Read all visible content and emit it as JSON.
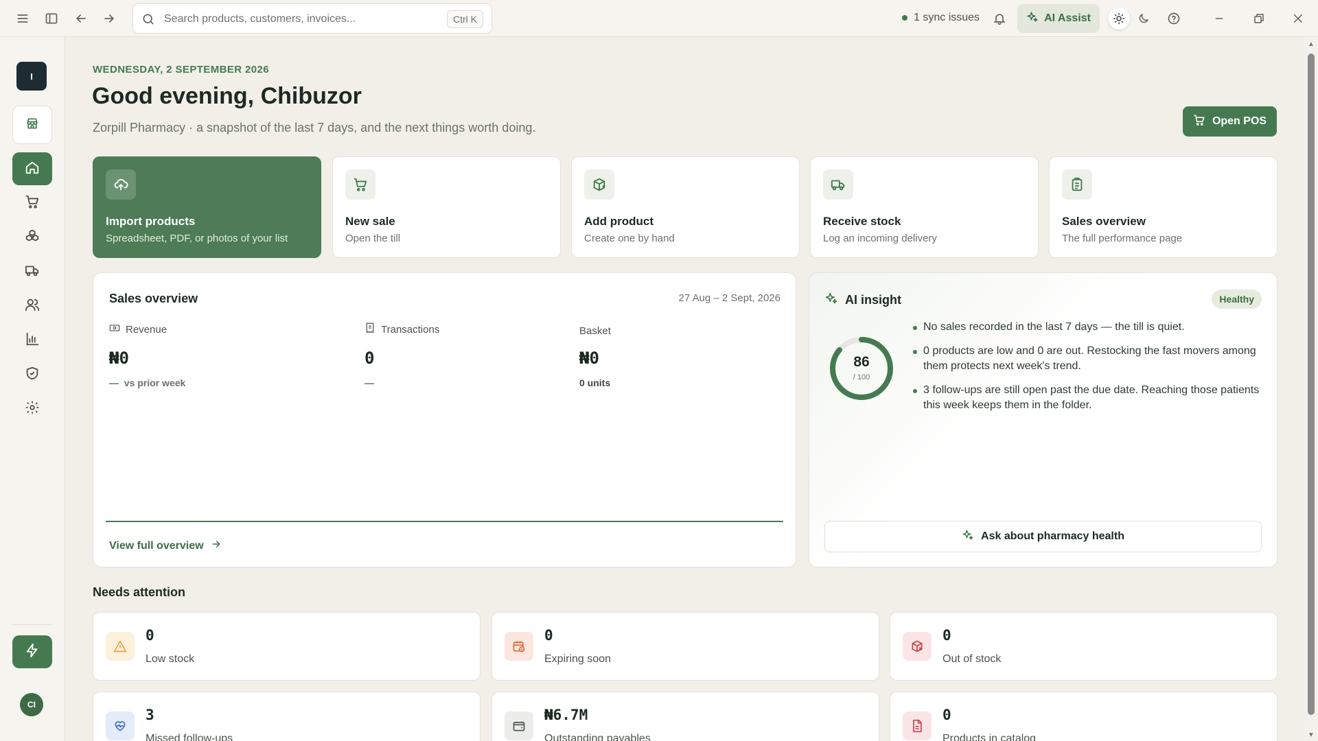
{
  "topbar": {
    "search_placeholder": "Search products, customers, invoices...",
    "shortcut": "Ctrl K",
    "sync_status": "1 sync issues",
    "ai_assist_label": "AI Assist"
  },
  "rail": {
    "workspace_initial": "I",
    "avatar_initials": "CI",
    "items": [
      "home-icon",
      "cart-icon",
      "boxes-icon",
      "truck-icon",
      "users-icon",
      "bar-chart-icon",
      "shield-check-icon",
      "gear-icon"
    ]
  },
  "header": {
    "date": "WEDNESDAY, 2 SEPTEMBER 2026",
    "greeting": "Good evening, Chibuzor",
    "subtitle": "Zorpill Pharmacy · a snapshot of the last 7 days, and the next things worth doing.",
    "open_pos_label": "Open POS"
  },
  "quick_actions": [
    {
      "title": "Import products",
      "subtitle": "Spreadsheet, PDF, or photos of your list",
      "icon": "cloud-upload-icon"
    },
    {
      "title": "New sale",
      "subtitle": "Open the till",
      "icon": "cart-icon"
    },
    {
      "title": "Add product",
      "subtitle": "Create one by hand",
      "icon": "package-plus-icon"
    },
    {
      "title": "Receive stock",
      "subtitle": "Log an incoming delivery",
      "icon": "truck-icon"
    },
    {
      "title": "Sales overview",
      "subtitle": "The full performance page",
      "icon": "clipboard-icon"
    }
  ],
  "sales_overview": {
    "title": "Sales overview",
    "range": "27 Aug – 2 Sept, 2026",
    "metrics": [
      {
        "label": "Revenue",
        "value": "₦0",
        "foot_mark": "—",
        "foot_text": "vs prior week"
      },
      {
        "label": "Transactions",
        "value": "0",
        "foot_mark": "—",
        "foot_text": ""
      },
      {
        "label": "Basket",
        "value": "₦0",
        "foot_mark": "",
        "foot_text": "0 units"
      }
    ],
    "view_link": "View full overview"
  },
  "ai_insight": {
    "title": "AI insight",
    "badge": "Healthy",
    "score": "86",
    "score_max": "/ 100",
    "score_fraction": 0.86,
    "bullets": [
      "No sales recorded in the last 7 days — the till is quiet.",
      "0 products are low and 0 are out. Restocking the fast movers among them protects next week's trend.",
      "3 follow-ups are still open past the due date. Reaching those patients this week keeps them in the folder."
    ],
    "ask_label": "Ask about pharmacy health"
  },
  "needs_attention": {
    "title": "Needs attention",
    "cards": [
      {
        "value": "0",
        "label": "Low stock",
        "icon": "warning-icon"
      },
      {
        "value": "0",
        "label": "Expiring soon",
        "icon": "calendar-clock-icon"
      },
      {
        "value": "0",
        "label": "Out of stock",
        "icon": "package-x-icon"
      },
      {
        "value": "3",
        "label": "Missed follow-ups",
        "icon": "heart-pulse-icon"
      },
      {
        "value": "₦6.7M",
        "label": "Outstanding payables",
        "icon": "wallet-icon"
      },
      {
        "value": "0",
        "label": "Products in catalog",
        "icon": "file-icon"
      }
    ]
  },
  "colors": {
    "accent": "#457a50",
    "background": "#f1efe8",
    "warning": "#e9a23b",
    "danger": "#c9444a",
    "info": "#3f6fc4"
  }
}
